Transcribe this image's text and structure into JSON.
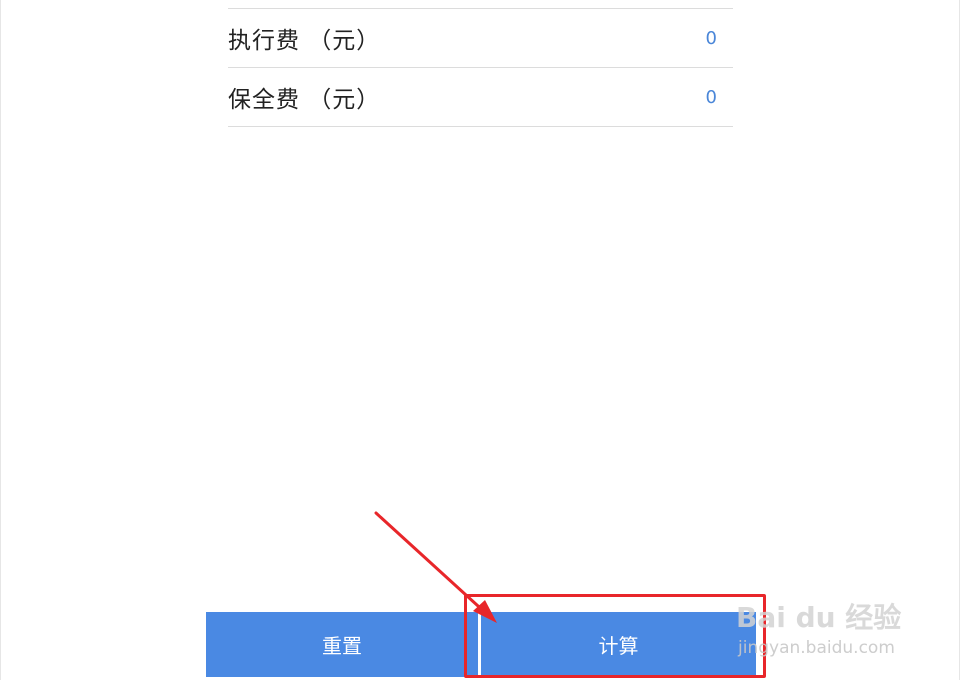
{
  "fees": [
    {
      "label": "执行费 （元）",
      "value": "0"
    },
    {
      "label": "保全费 （元）",
      "value": "0"
    }
  ],
  "buttons": {
    "reset_label": "重置",
    "calculate_label": "计算"
  },
  "watermark": {
    "logo_text": "Bai du 经验",
    "sub_text": "jingyan.baidu.com"
  },
  "colors": {
    "button_blue": "#4a89e3",
    "value_blue": "#4a86d8",
    "annotation_red": "#e8262a"
  },
  "icons": {
    "annotation": "arrow-pointer-icon"
  }
}
